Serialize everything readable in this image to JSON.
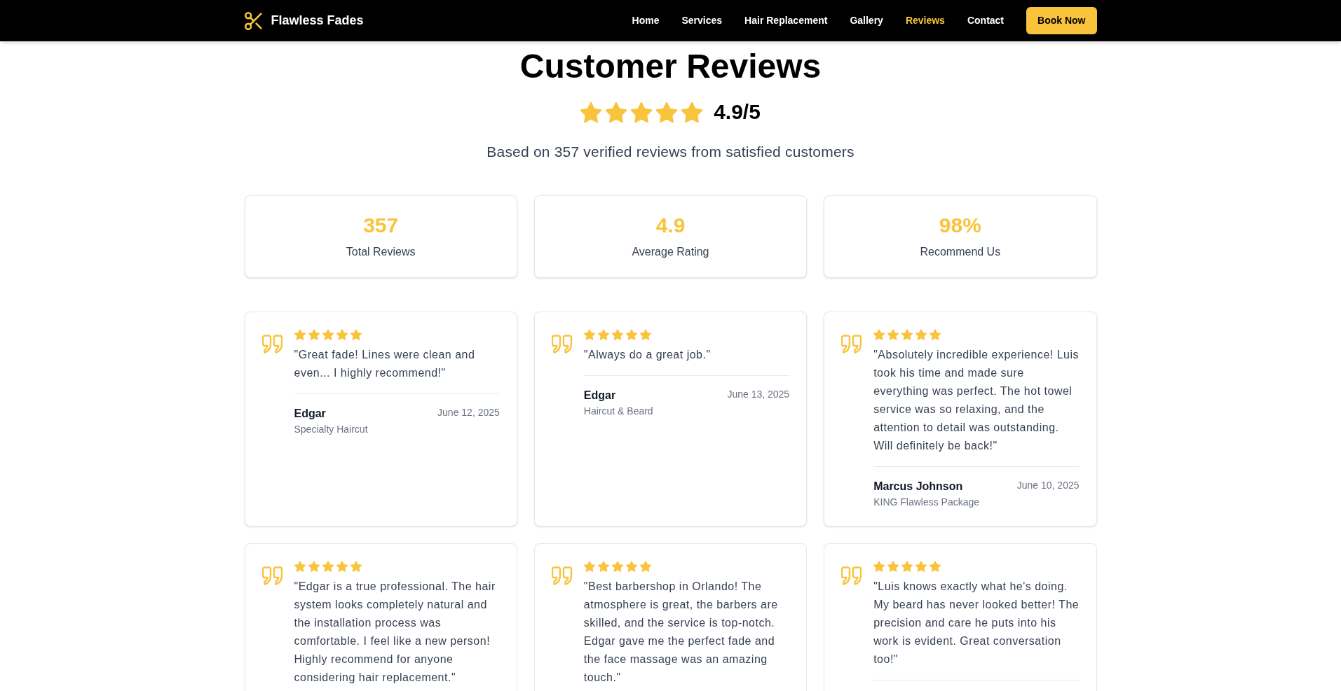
{
  "header": {
    "brand": "Flawless Fades",
    "nav": [
      {
        "label": "Home",
        "selected": false
      },
      {
        "label": "Services",
        "selected": false
      },
      {
        "label": "Hair Replacement",
        "selected": false
      },
      {
        "label": "Gallery",
        "selected": false
      },
      {
        "label": "Reviews",
        "selected": true
      },
      {
        "label": "Contact",
        "selected": false
      }
    ],
    "cta": "Book Now"
  },
  "hero": {
    "title": "Customer Reviews",
    "stars": 5,
    "rating": "4.9/5",
    "subtitle": "Based on 357 verified reviews from satisfied customers"
  },
  "stats": [
    {
      "value": "357",
      "label": "Total Reviews"
    },
    {
      "value": "4.9",
      "label": "Average Rating"
    },
    {
      "value": "98%",
      "label": "Recommend Us"
    }
  ],
  "reviews": [
    {
      "stars": 5,
      "quote": "\"Great fade! Lines were clean and even... I highly recommend!\"",
      "author": "Edgar",
      "service": "Specialty Haircut",
      "date": "June 12, 2025"
    },
    {
      "stars": 5,
      "quote": "\"Always do a great job.\"",
      "author": "Edgar",
      "service": "Haircut & Beard",
      "date": "June 13, 2025"
    },
    {
      "stars": 5,
      "quote": "\"Absolutely incredible experience! Luis took his time and made sure everything was perfect. The hot towel service was so relaxing, and the attention to detail was outstanding. Will definitely be back!\"",
      "author": "Marcus Johnson",
      "service": "KING Flawless Package",
      "date": "June 10, 2025"
    },
    {
      "stars": 5,
      "quote": "\"Edgar is a true professional. The hair system looks completely natural and the installation process was comfortable. I feel like a new person! Highly recommend for anyone considering hair replacement.\""
    },
    {
      "stars": 5,
      "quote": "\"Best barbershop in Orlando! The atmosphere is great, the barbers are skilled, and the service is top-notch. Edgar gave me the perfect fade and the face massage was an amazing touch.\""
    },
    {
      "stars": 5,
      "quote": "\"Luis knows exactly what he's doing. My beard has never looked better! The precision and care he puts into his work is evident. Great conversation too!\""
    }
  ]
}
